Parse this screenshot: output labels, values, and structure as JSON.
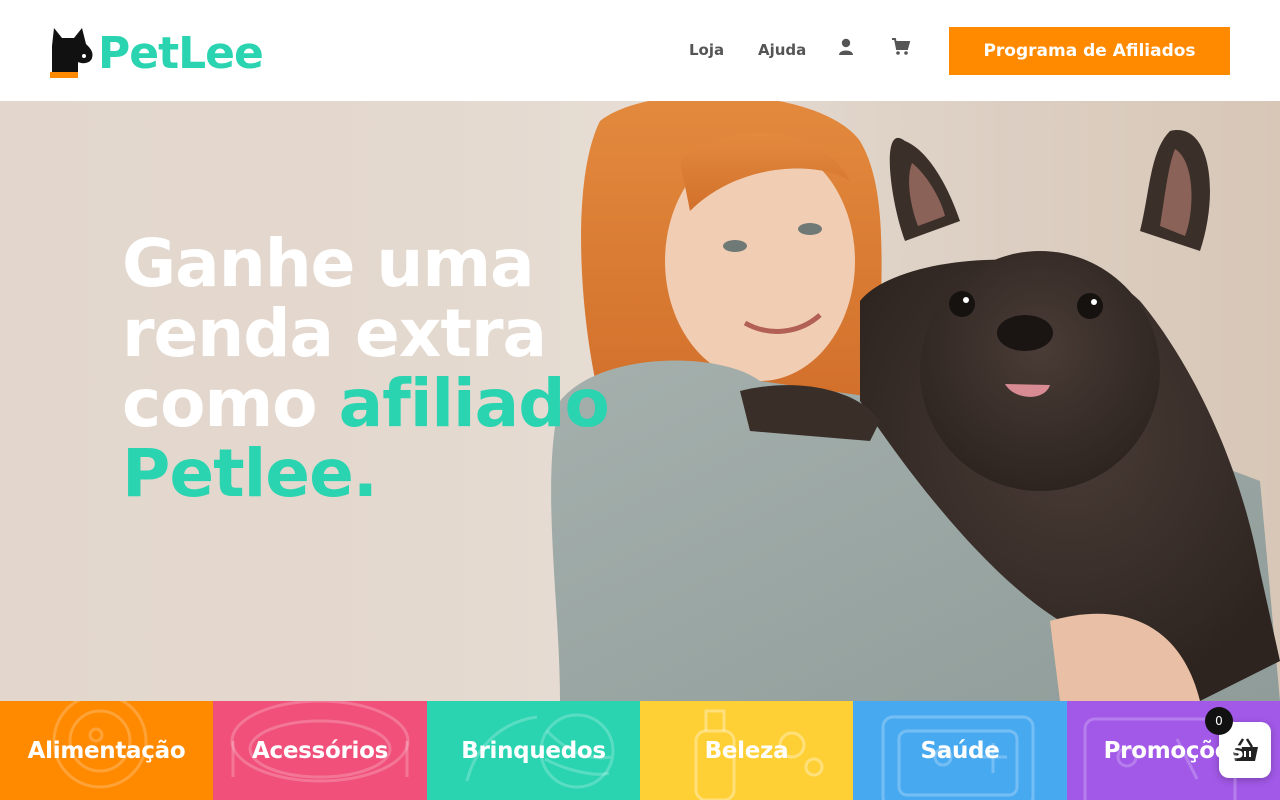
{
  "header": {
    "logo_text": "PetLee",
    "nav": {
      "shop_label": "Loja",
      "help_label": "Ajuda",
      "account_icon": "user-icon",
      "cart_icon": "cart-icon"
    },
    "cta_label": "Programa de Afiliados"
  },
  "hero": {
    "headline_line1": "Ganhe uma",
    "headline_line2": "renda extra",
    "headline_line3_plain": "como ",
    "headline_line3_accent": "afiliado",
    "headline_line4_accent": "Petlee."
  },
  "categories": [
    {
      "label": "Alimentação",
      "color": "#ff8a00"
    },
    {
      "label": "Acessórios",
      "color": "#f0507a"
    },
    {
      "label": "Brinquedos",
      "color": "#2bd4b1"
    },
    {
      "label": "Beleza",
      "color": "#ffd035"
    },
    {
      "label": "Saúde",
      "color": "#47a9f0"
    },
    {
      "label": "Promoções",
      "color": "#a259e8"
    }
  ],
  "floating_cart": {
    "count": "0",
    "icon": "basket-icon"
  },
  "colors": {
    "brand_teal": "#2bd4b1",
    "brand_orange": "#ff8a00",
    "nav_text": "#555555"
  }
}
